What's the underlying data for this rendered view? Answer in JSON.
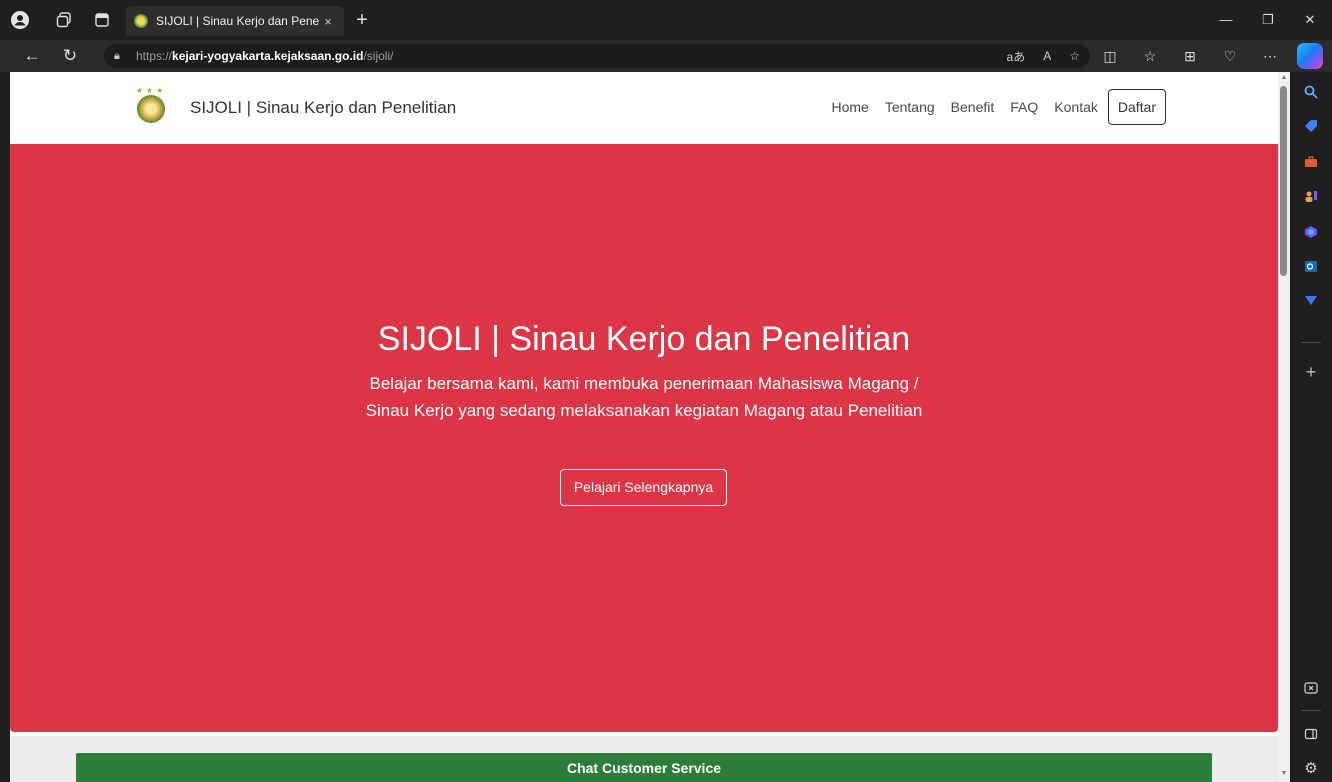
{
  "browser": {
    "tab_title": "SIJOLI | Sinau Kerjo dan Penelitian",
    "close_tab": "×",
    "new_tab": "+",
    "url_prefix": "https://",
    "url_host": "kejari-yogyakarta.kejaksaan.go.id",
    "url_path": "/sijoli/",
    "url_icons": [
      "aあ",
      "A",
      "☆"
    ]
  },
  "site": {
    "brand": "SIJOLI | Sinau Kerjo dan Penelitian",
    "nav": {
      "home": "Home",
      "tentang": "Tentang",
      "benefit": "Benefit",
      "faq": "FAQ",
      "kontak": "Kontak",
      "daftar": "Daftar"
    },
    "hero": {
      "title": "SIJOLI | Sinau Kerjo dan Penelitian",
      "description": "Belajar bersama kami, kami membuka penerimaan Mahasiswa Magang / Sinau Kerjo yang sedang melaksanakan kegiatan Magang atau Penelitian",
      "cta": "Pelajari Selengkapnya"
    },
    "chat_button": "Chat Customer Service"
  },
  "colors": {
    "hero_bg": "#dc3545",
    "chat_bg": "#2d7d3a",
    "browser_chrome": "#202020"
  },
  "sidebar_icons": [
    "search-icon",
    "tag-icon",
    "toolbox-icon",
    "people-icon",
    "office-icon",
    "outlook-icon",
    "send-icon",
    "add-icon",
    "screenshot-icon",
    "layout-icon",
    "settings-icon"
  ]
}
